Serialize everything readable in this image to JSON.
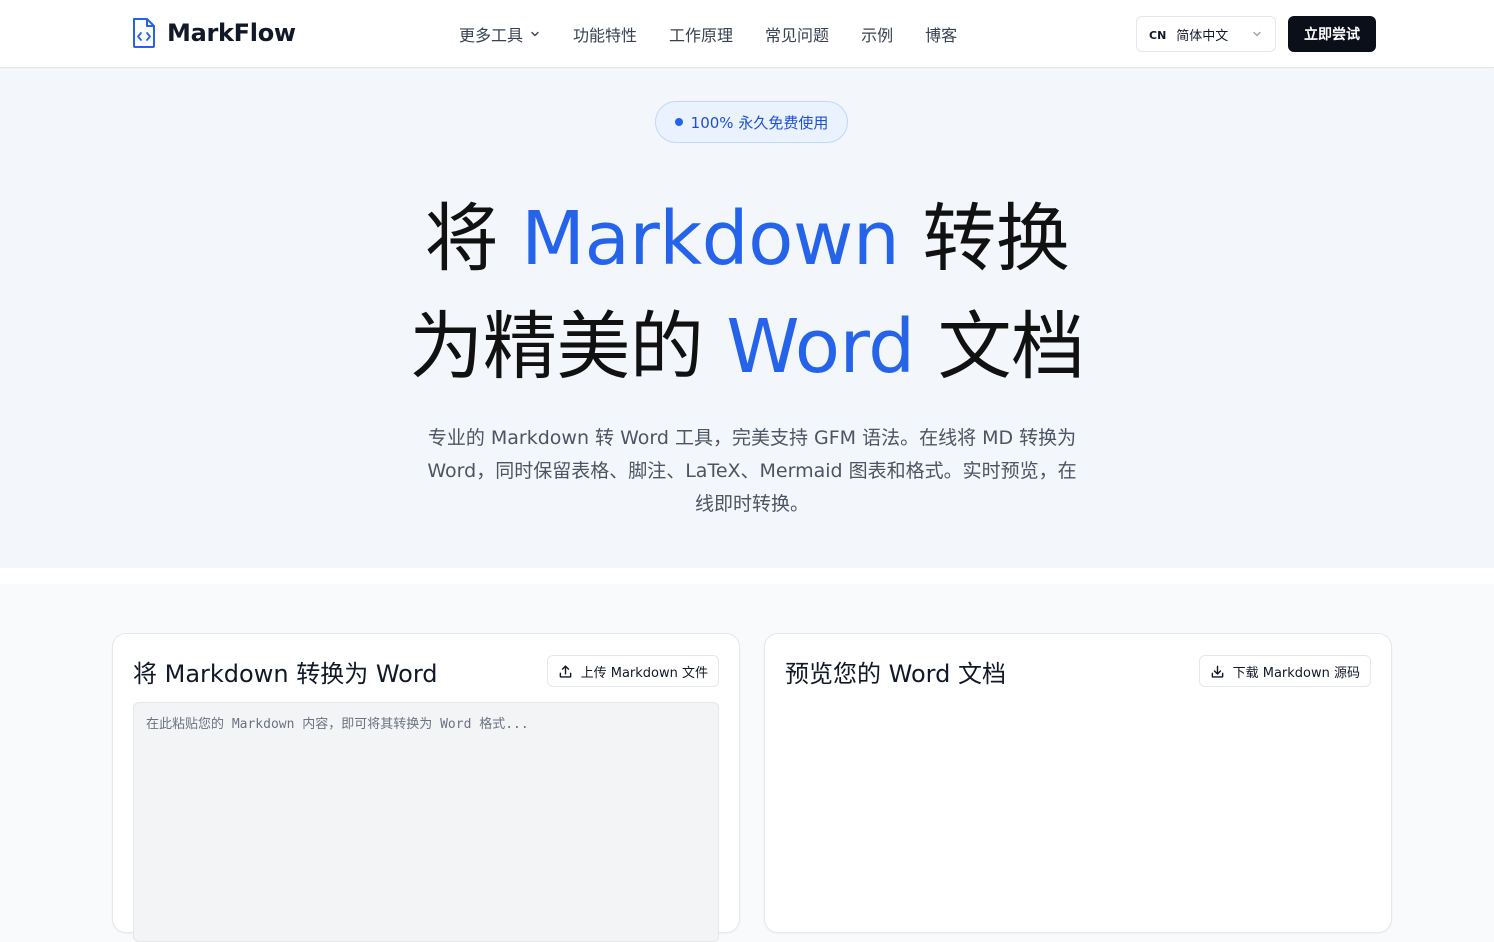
{
  "header": {
    "brand": "MarkFlow",
    "nav": [
      {
        "label": "更多工具"
      },
      {
        "label": "功能特性"
      },
      {
        "label": "工作原理"
      },
      {
        "label": "常见问题"
      },
      {
        "label": "示例"
      },
      {
        "label": "博客"
      }
    ],
    "language": {
      "code": "CN",
      "label": "简体中文"
    },
    "cta_label": "立即尝试"
  },
  "hero": {
    "badge": "100% 永久免费使用",
    "title_line1_a": "将 ",
    "title_line1_hl": "Markdown",
    "title_line1_b": " 转换",
    "title_line2_a": "为精美的 ",
    "title_line2_hl": "Word",
    "title_line2_b": " 文档",
    "description": "专业的 Markdown 转 Word 工具，完美支持 GFM 语法。在线将 MD 转换为 Word，同时保留表格、脚注、LaTeX、Mermaid 图表和格式。实时预览，在线即时转换。"
  },
  "editor_panel": {
    "title": "将 Markdown 转换为 Word",
    "upload_label": "上传 Markdown 文件",
    "placeholder": "在此粘贴您的 Markdown 内容，即可将其转换为 Word 格式..."
  },
  "preview_panel": {
    "title": "预览您的 Word 文档",
    "download_label": "下载 Markdown 源码"
  },
  "colors": {
    "accent": "#2563eb",
    "cta_bg": "#0b0f19",
    "badge_bg": "#eaf2fe"
  },
  "icons": {
    "logo": "document-code-icon",
    "nav_dropdown": "chevron-down-icon",
    "lang_dropdown": "chevron-down-icon",
    "upload": "upload-icon",
    "download": "download-icon"
  }
}
